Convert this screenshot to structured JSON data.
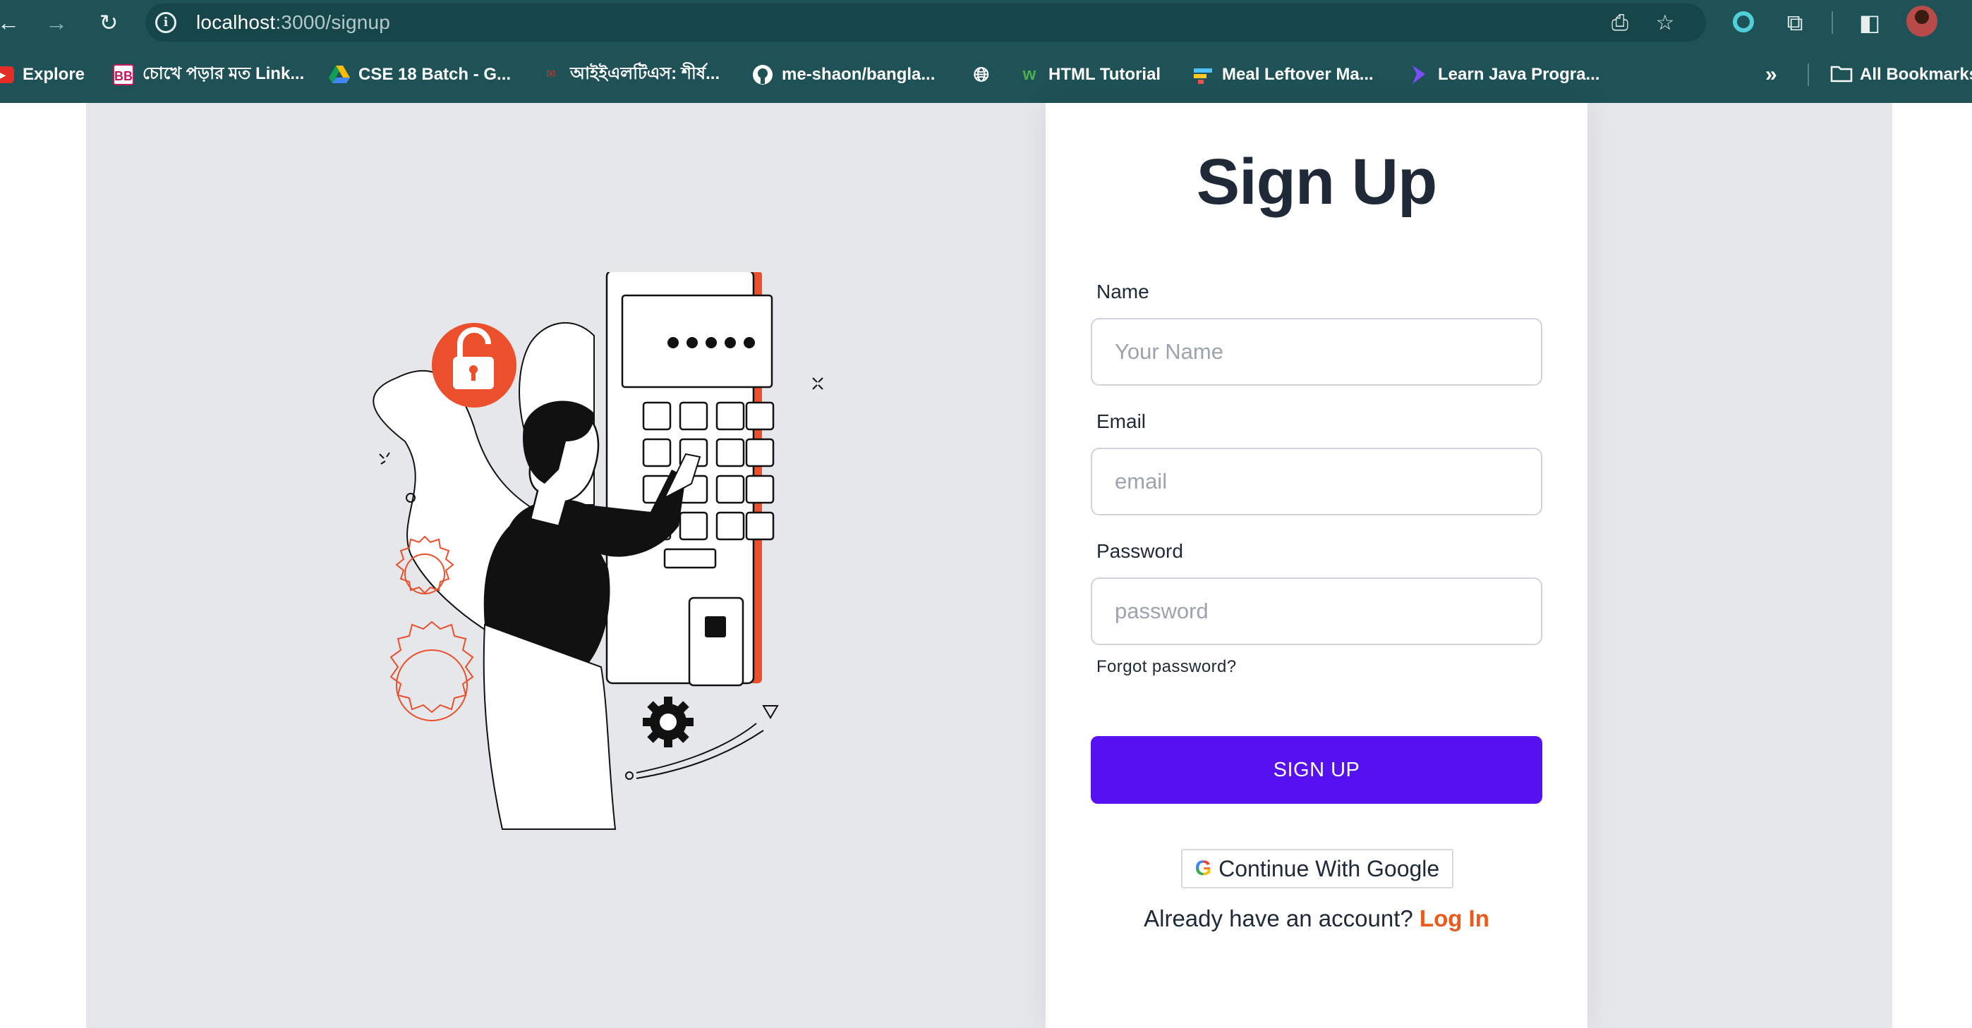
{
  "browser": {
    "url_host": "localhost",
    "url_path": ":3000/signup",
    "bookmarks": [
      {
        "label": "Explore",
        "icon": "youtube-icon"
      },
      {
        "label": "চোখে পড়ার মত Link...",
        "icon": "bb-icon"
      },
      {
        "label": "CSE 18 Batch - G...",
        "icon": "google-drive-icon"
      },
      {
        "label": "আইইএলটিএস: শীর্ষ...",
        "icon": "site-icon"
      },
      {
        "label": "me-shaon/bangla...",
        "icon": "github-icon"
      },
      {
        "label": "",
        "icon": "globe-icon"
      },
      {
        "label": "HTML Tutorial",
        "icon": "w3schools-icon"
      },
      {
        "label": "Meal Leftover Ma...",
        "icon": "app-icon"
      },
      {
        "label": "Learn Java Progra...",
        "icon": "java-icon"
      }
    ],
    "all_bookmarks": "All Bookmarks"
  },
  "signup": {
    "title": "Sign Up",
    "name_label": "Name",
    "name_placeholder": "Your Name",
    "email_label": "Email",
    "email_placeholder": "email",
    "password_label": "Password",
    "password_placeholder": "password",
    "forgot": "Forgot password?",
    "submit": "SIGN UP",
    "google": "Continue With Google",
    "have_account": "Already have an account?",
    "login": "Log In"
  },
  "colors": {
    "chrome": "#1e5257",
    "accent": "#5511ef",
    "link": "#ea5a1c",
    "illustration_accent": "#ec4f2b"
  }
}
